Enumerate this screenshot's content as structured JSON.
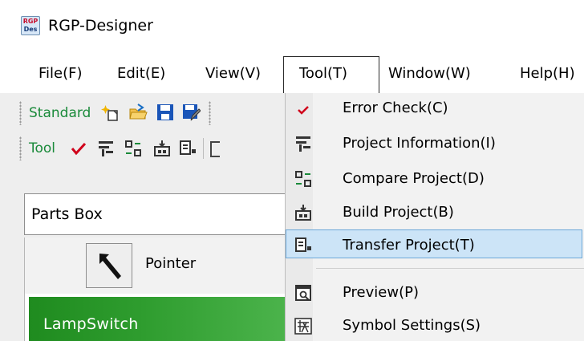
{
  "window": {
    "app_icon_top": "RGP",
    "app_icon_bottom": "Des",
    "title": "RGP-Designer"
  },
  "menubar": {
    "items": [
      {
        "label": "File(F)"
      },
      {
        "label": "Edit(E)"
      },
      {
        "label": "View(V)"
      },
      {
        "label": "Tool(T)"
      },
      {
        "label": "Window(W)"
      },
      {
        "label": "Help(H)"
      }
    ],
    "open_menu": "Tool(T)"
  },
  "toolbars": {
    "standard": {
      "label": "Standard",
      "icons": [
        "new-project-icon",
        "open-folder-icon",
        "save-icon",
        "save-as-icon"
      ]
    },
    "tool": {
      "label": "Tool",
      "icons": [
        "error-check-icon",
        "project-information-icon",
        "compare-project-icon",
        "build-project-icon",
        "transfer-project-icon"
      ]
    }
  },
  "parts_panel": {
    "title": "Parts Box",
    "items": [
      {
        "label": "Pointer",
        "icon": "pointer-arrow-icon"
      },
      {
        "label": "LampSwitch",
        "selected": true
      }
    ]
  },
  "tool_menu": {
    "items": [
      {
        "label": "Error Check(C)",
        "icon": "checkmark-icon"
      },
      {
        "label": "Project Information(I)",
        "icon": "project-information-icon"
      },
      {
        "label": "Compare Project(D)",
        "icon": "compare-project-icon"
      },
      {
        "label": "Build Project(B)",
        "icon": "build-project-icon"
      },
      {
        "label": "Transfer Project(T)",
        "icon": "transfer-project-icon",
        "highlighted": true
      },
      {
        "label": "Preview(P)",
        "icon": "preview-icon"
      },
      {
        "label": "Symbol Settings(S)",
        "icon": "symbol-settings-icon"
      }
    ]
  },
  "colors": {
    "toolbar_label": "#1a8a3a",
    "selected_part": "#2f9d2f",
    "menu_highlight": "#cce4f7",
    "menu_highlight_border": "#6ba7d8",
    "check": "#d0021b"
  }
}
